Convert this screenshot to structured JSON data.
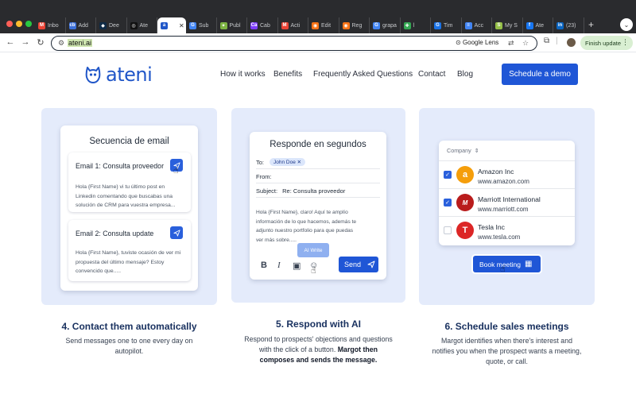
{
  "browser": {
    "tabs": [
      {
        "label": "Inbo",
        "icon": "gmail-icon",
        "color": "#ea4335",
        "glyph": "M"
      },
      {
        "label": "Add",
        "icon": "cb-icon",
        "color": "#3b6fd8",
        "glyph": "cb"
      },
      {
        "label": "Dee",
        "icon": "deepl-icon",
        "color": "#0f2b46",
        "glyph": "◆"
      },
      {
        "label": "Ate",
        "icon": "chatgpt-icon",
        "color": "#111111",
        "glyph": "◎"
      },
      {
        "label": "",
        "icon": "ateni-icon",
        "color": "#2056c8",
        "glyph": "a",
        "active": true
      },
      {
        "label": "Sub",
        "icon": "google-icon",
        "color": "#4285f4",
        "glyph": "G"
      },
      {
        "label": "Publ",
        "icon": "leaf-icon",
        "color": "#7cb342",
        "glyph": "✦"
      },
      {
        "label": "Cab",
        "icon": "canva-icon",
        "color": "#7d3cff",
        "glyph": "Ca"
      },
      {
        "label": "Acti",
        "icon": "gmail-icon",
        "color": "#ea4335",
        "glyph": "M"
      },
      {
        "label": "Edit",
        "icon": "orange-icon",
        "color": "#f97316",
        "glyph": "◉"
      },
      {
        "label": "Reg",
        "icon": "orange-icon",
        "color": "#f97316",
        "glyph": "◉"
      },
      {
        "label": "grapa",
        "icon": "google-icon",
        "color": "#4285f4",
        "glyph": "G"
      },
      {
        "label": "l",
        "icon": "tool-icon",
        "color": "#34a853",
        "glyph": "✚"
      },
      {
        "label": "Tim",
        "icon": "calendar-icon",
        "color": "#1a73e8",
        "glyph": "G"
      },
      {
        "label": "Acc",
        "icon": "docs-icon",
        "color": "#4285f4",
        "glyph": "≡"
      },
      {
        "label": "My S",
        "icon": "shopify-icon",
        "color": "#95bf47",
        "glyph": "S"
      },
      {
        "label": "Ate",
        "icon": "facebook-icon",
        "color": "#1877f2",
        "glyph": "f"
      },
      {
        "label": "(23)",
        "icon": "linkedin-icon",
        "color": "#0a66c2",
        "glyph": "in"
      }
    ],
    "active_tab_close": "✕",
    "new_tab": "+",
    "tab_menu": "⌄",
    "back": "←",
    "forward": "→",
    "reload": "↻",
    "url": "ateni.ai",
    "lens_label": "Google Lens",
    "finish_update": "Finish update"
  },
  "site": {
    "logo": "ateni",
    "brand_color": "#2056c8",
    "nav": [
      "How it works",
      "Benefits",
      "Frequently Asked Questions",
      "Contact",
      "Blog"
    ],
    "cta": "Schedule a demo"
  },
  "card1": {
    "title": "Secuencia de email",
    "emails": [
      {
        "subject": "Email 1: Consulta proveedor",
        "body": "Hola {First Name} vi tu último post en Linkedin comentando que buscabas una solución de CRM para vuestra empresa..."
      },
      {
        "subject": "Email 2: Consulta update",
        "body": "Hola {First Name}, tuviste ocasión de ver mi propuesta del último mensaje? Estoy convencido que....."
      }
    ],
    "caption_title": "4. Contact them automatically",
    "caption_text": "Send messages one to one every day on autopilot."
  },
  "card2": {
    "title": "Responde en segundos",
    "to_label": "To:",
    "to_chip": "John Doe",
    "from_label": "From:",
    "subject_label": "Subject:",
    "subject_value": "Re: Consulta proveedor",
    "body": "Hola {First Name}, claro! Aquí te amplío información de lo que hacemos, además te adjunto nuestro portfolio para que puedas ver más sobre.....",
    "ai_write": "AI Write",
    "send": "Send",
    "caption_title": "5. Respond with AI",
    "caption_text": "Respond to prospects' objections and questions with the click of a button.",
    "caption_bold": "Margot then composes and sends the message."
  },
  "card3": {
    "column_header": "Company",
    "companies": [
      {
        "name": "Amazon Inc",
        "web": "www.amazon.com",
        "checked": true,
        "color": "#f59e0b",
        "glyph": "a"
      },
      {
        "name": "Marriott International",
        "web": "www.marriott.com",
        "checked": true,
        "color": "#b91c1c",
        "glyph": "M"
      },
      {
        "name": "Tesla Inc",
        "web": "www.tesla.com",
        "checked": false,
        "color": "#dc2626",
        "glyph": "T"
      }
    ],
    "book": "Book meeting",
    "caption_title": "6. Schedule sales meetings",
    "caption_text": "Margot identifies when there's interest and notifies you when the prospect wants a meeting, quote, or call."
  }
}
